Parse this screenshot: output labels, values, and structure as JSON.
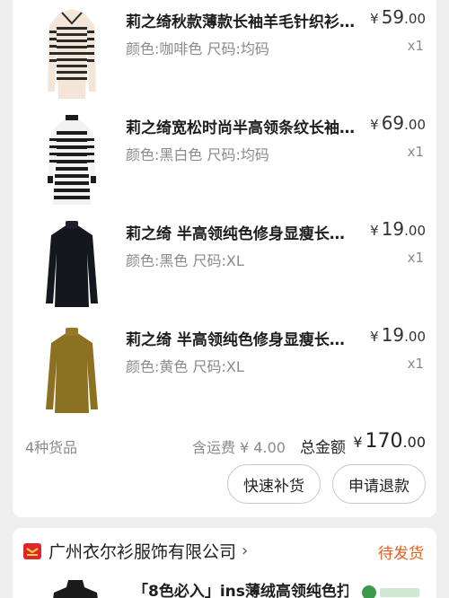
{
  "order": {
    "items": [
      {
        "title": "莉之绮秋款薄款长袖羊毛针织衫…",
        "attrs": "颜色:咖啡色 尺码:均码",
        "price_currency": "¥",
        "price_int": "59",
        "price_dec": ".00",
        "qty": "x1",
        "thumb": "striped-cardigan-beige"
      },
      {
        "title": "莉之绮宽松时尚半高领条纹长袖…",
        "attrs": "颜色:黑白色 尺码:均码",
        "price_currency": "¥",
        "price_int": "69",
        "price_dec": ".00",
        "qty": "x1",
        "thumb": "striped-dress-black-white"
      },
      {
        "title": "莉之绮 半高领纯色修身显瘦长…",
        "attrs": "颜色:黑色 尺码:XL",
        "price_currency": "¥",
        "price_int": "19",
        "price_dec": ".00",
        "qty": "x1",
        "thumb": "turtleneck-black"
      },
      {
        "title": "莉之绮 半高领纯色修身显瘦长…",
        "attrs": "颜色:黄色 尺码:XL",
        "price_currency": "¥",
        "price_int": "19",
        "price_dec": ".00",
        "qty": "x1",
        "thumb": "turtleneck-mustard"
      }
    ],
    "summary": {
      "count_text": "4种货品",
      "shipping_text": "含运费 ¥ 4.00",
      "total_label": "总金额",
      "total_currency": "¥",
      "total_int": "170",
      "total_dec": ".00"
    },
    "buttons": {
      "restock": "快速补货",
      "refund": "申请退款"
    }
  },
  "shop": {
    "name": "广州衣尔衫服饰有限公司",
    "status": "待发货",
    "icon": "shop-flag-icon",
    "next_item_title": "「8色必入」ins薄绒高领纯色打…"
  },
  "colors": {
    "status_orange": "#e85d1a",
    "shop_icon_red": "#e0262a"
  }
}
